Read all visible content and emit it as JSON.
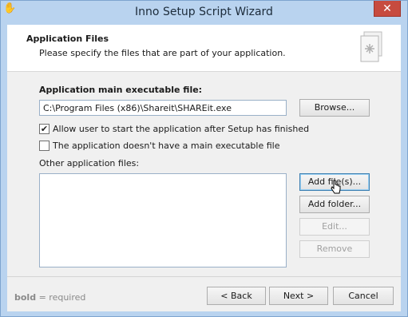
{
  "window": {
    "title": "Inno Setup Script Wizard",
    "close_label": "✕",
    "app_icon": "hand-icon"
  },
  "header": {
    "title": "Application Files",
    "subtitle": "Please specify the files that are part of your application.",
    "icon": "wizard-document-icon"
  },
  "form": {
    "main_exe_label": "Application main executable file:",
    "main_exe_value": "C:\\Program Files (x86)\\Shareit\\SHAREit.exe",
    "browse_label": "Browse...",
    "allow_start": {
      "label": "Allow user to start the application after Setup has finished",
      "checked": true
    },
    "no_main_exe": {
      "label": "The application doesn't have a main executable file",
      "checked": false
    },
    "other_files_label": "Other application files:",
    "other_files": [],
    "add_files_label": "Add file(s)...",
    "add_folder_label": "Add folder...",
    "edit_label": "Edit...",
    "remove_label": "Remove"
  },
  "footer": {
    "bold_word": "bold",
    "note_rest": " = required",
    "back_label": "< Back",
    "next_label": "Next >",
    "cancel_label": "Cancel"
  }
}
